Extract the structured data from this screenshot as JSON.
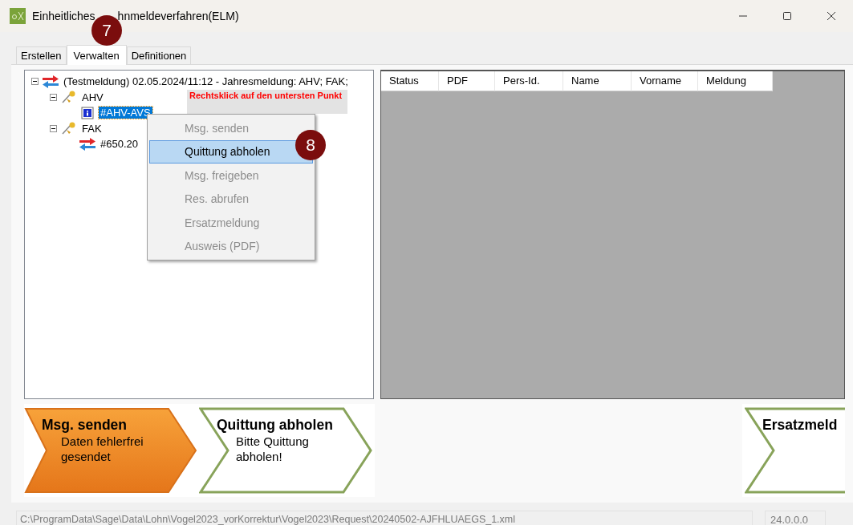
{
  "window": {
    "title_start": "Einheitliches",
    "title_end": "hnmeldeverfahren(ELM)"
  },
  "badges": [
    {
      "label": "7"
    },
    {
      "label": "8"
    }
  ],
  "tabs": [
    {
      "label": "Erstellen",
      "selected": false
    },
    {
      "label": "Verwalten",
      "selected": true
    },
    {
      "label": "Definitionen",
      "selected": false
    }
  ],
  "tree": [
    {
      "label": "(Testmeldung) 02.05.2024/11:12 - Jahresmeldung: AHV; FAK;",
      "kind": "exchange",
      "expanded": true,
      "selected": false,
      "children": [
        {
          "label": "AHV",
          "kind": "pin",
          "expanded": true,
          "selected": false,
          "children": [
            {
              "label": "#AHV-AVS",
              "kind": "info",
              "selected": true
            }
          ]
        },
        {
          "label": "FAK",
          "kind": "pin",
          "expanded": true,
          "selected": false,
          "children": [
            {
              "label": "#650.20",
              "kind": "exchange",
              "selected": false
            }
          ]
        }
      ]
    }
  ],
  "tooltip": {
    "text": "Rechtsklick auf den untersten Punkt"
  },
  "context_menu": [
    {
      "label": "Msg. senden",
      "disabled": true,
      "selected": false
    },
    {
      "label": "Quittung abholen",
      "disabled": false,
      "selected": true
    },
    {
      "label": "Msg. freigeben",
      "disabled": true,
      "selected": false
    },
    {
      "label": "Res. abrufen",
      "disabled": true,
      "selected": false
    },
    {
      "label": "Ersatzmeldung",
      "disabled": true,
      "selected": false
    },
    {
      "label": "Ausweis (PDF)",
      "disabled": true,
      "selected": false
    }
  ],
  "table": {
    "columns": [
      "Status",
      "PDF",
      "Pers-Id.",
      "Name",
      "Vorname",
      "Meldung"
    ]
  },
  "steps": [
    {
      "title": "Msg. senden",
      "text": "Daten fehlerfrei gesendet",
      "kind": "active"
    },
    {
      "title": "Quittung abholen",
      "text": "Bitte Quittung abholen!",
      "kind": "pending"
    }
  ],
  "right_steps": [
    {
      "title": "Ersatzmeld",
      "kind": "pending"
    }
  ],
  "status_bar": {
    "path": "C:\\ProgramData\\Sage\\Data\\Lohn\\Vogel2023_vorKorrektur\\Vogel2023\\Request\\20240502-AJFHLUAEGS_1.xml",
    "version": "24.0.0.0"
  }
}
